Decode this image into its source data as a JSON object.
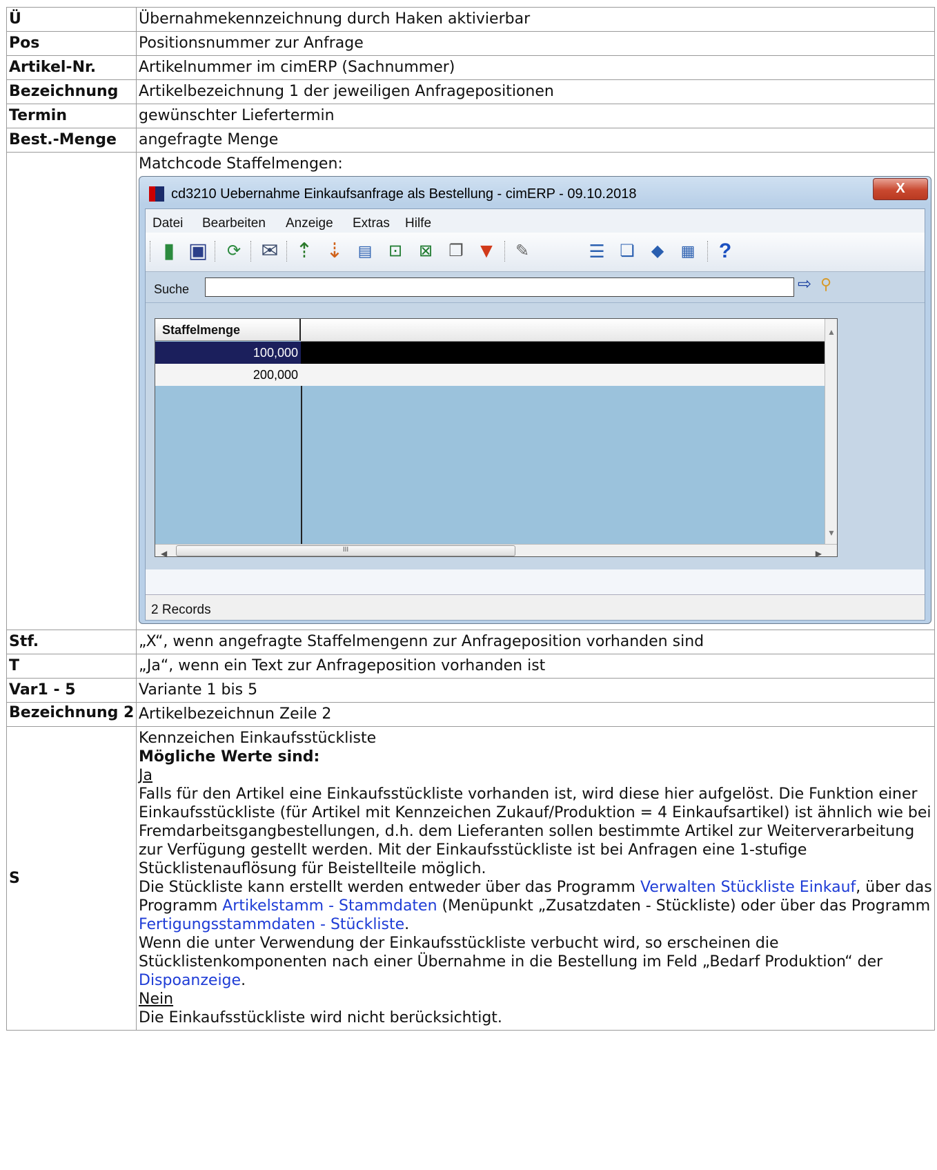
{
  "rows": [
    {
      "key": "Ü",
      "value": "Übernahmekennzeichnung durch Haken aktivierbar"
    },
    {
      "key": "Pos",
      "value": "Positionsnummer zur Anfrage"
    },
    {
      "key": "Artikel-Nr.",
      "value": "Artikelnummer im cimERP (Sachnummer)"
    },
    {
      "key": "Bezeichnung",
      "value": "Artikelbezeichnung 1 der jeweiligen Anfragepositionen"
    },
    {
      "key": "Termin",
      "value": "gewünschter Liefertermin"
    },
    {
      "key": "Best.-Menge",
      "value": "angefragte Menge"
    }
  ],
  "matchcode_label": "Matchcode Staffelmengen:",
  "window": {
    "title": "cd3210 Uebernahme Einkaufsanfrage als Bestellung - cimERP - 09.10.2018",
    "close": "X",
    "menu": [
      "Datei",
      "Bearbeiten",
      "Anzeige",
      "Extras",
      "Hilfe"
    ],
    "search_label": "Suche",
    "search_value": "",
    "column_header": "Staffelmenge",
    "values": [
      "100,000",
      "200,000"
    ],
    "scroll_grip": "III",
    "status": "2 Records"
  },
  "rows2": [
    {
      "key": "Stf.",
      "value": "„X“, wenn angefragte Staffelmengenn zur Anfrageposition vorhanden sind"
    },
    {
      "key": "T",
      "value": "„Ja“, wenn ein Text zur Anfrageposition vorhanden ist"
    },
    {
      "key": "Var1 - 5",
      "value": "Variante 1 bis 5"
    },
    {
      "key": "Bezeichnung 2",
      "value": "Artikelbezeichnun Zeile 2"
    }
  ],
  "s_row": {
    "key": "S",
    "title": "Kennzeichen Einkaufsstückliste",
    "possible": "Mögliche Werte sind:",
    "ja": "Ja",
    "ja_text": "Falls für den Artikel eine Einkaufsstückliste vorhanden ist, wird diese hier aufgelöst. Die Funktion einer Einkaufsstückliste (für Artikel mit Kennzeichen Zukauf/Produktion = 4 Einkaufsartikel) ist ähnlich wie bei Fremdarbeitsgangbestellungen, d.h. dem Lieferanten sollen bestimmte Artikel zur Weiterverarbeitung zur Verfügung gestellt werden. Mit der Einkaufsstückliste ist bei Anfragen eine 1-stufige Stücklistenauflösung für Beistellteile möglich.",
    "p2_a": "Die Stückliste kann erstellt werden entweder über das Programm ",
    "link1": "Verwalten Stückliste Einkauf",
    "p2_b": ", über das Programm ",
    "link2": "Artikelstamm - Stammdaten",
    "p2_c": " (Menüpunkt „Zusatzdaten - Stückliste) oder über das Programm ",
    "link3": "Fertigungsstammdaten - Stückliste",
    "p2_d": ".",
    "p3_a": "Wenn die unter Verwendung der Einkaufsstückliste verbucht wird, so erscheinen die Stücklistenkomponenten nach einer Übernahme in die Bestellung im Feld „Bedarf Produktion“ der ",
    "link4": "Dispoanzeige",
    "p3_b": ".",
    "nein": "Nein",
    "nein_text": "Die Einkaufsstückliste wird nicht berücksichtigt."
  }
}
